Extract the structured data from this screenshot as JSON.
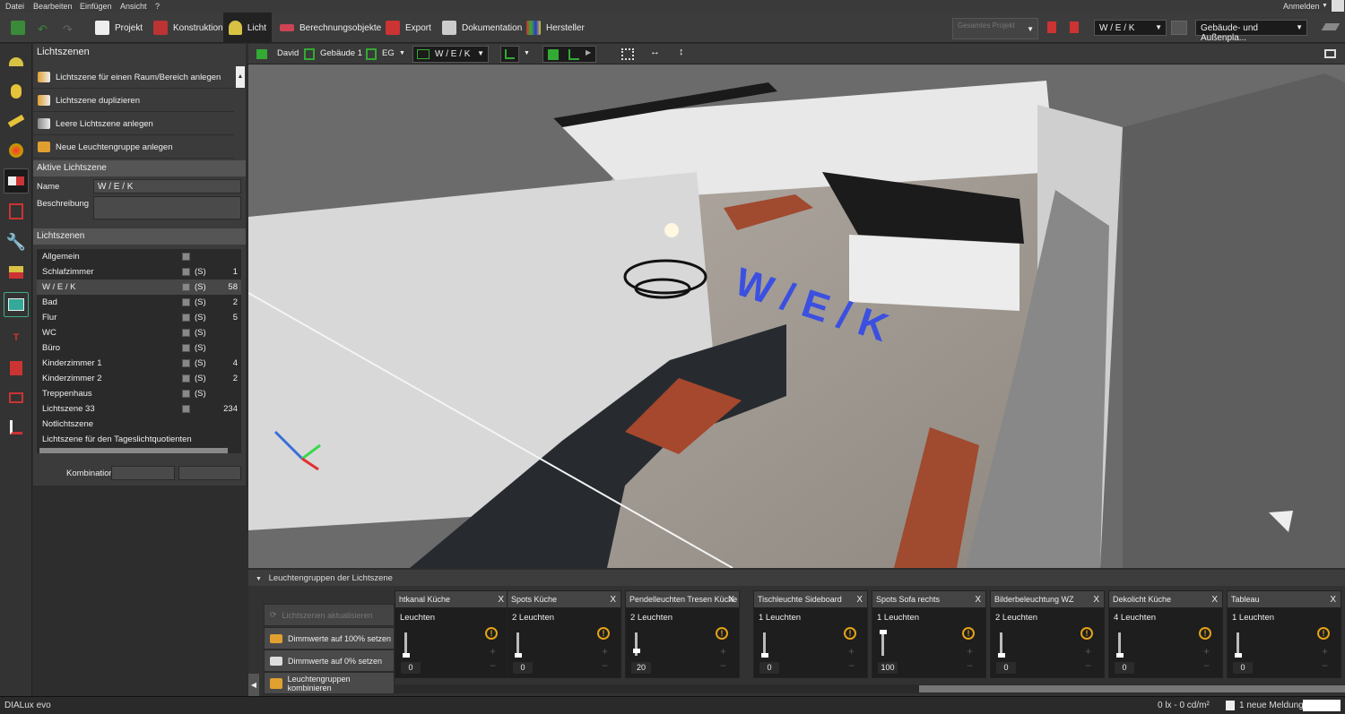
{
  "menu": [
    "Datei",
    "Bearbeiten",
    "Einfügen",
    "Ansicht",
    "?"
  ],
  "user": {
    "label": "Anmelden"
  },
  "tabs": [
    {
      "label": "Projekt"
    },
    {
      "label": "Konstruktion"
    },
    {
      "label": "Licht"
    },
    {
      "label": "Berechnungsobjekte"
    },
    {
      "label": "Export"
    },
    {
      "label": "Dokumentation"
    },
    {
      "label": "Hersteller"
    }
  ],
  "toolbar_right": {
    "project_combo": "Gesamtes Projekt",
    "scene_combo": "W / E / K",
    "view_combo": "Gebäude- und Außenpla..."
  },
  "viewbar": {
    "site": "David",
    "building": "Gebäude 1",
    "floor": "EG",
    "scene": "W / E / K"
  },
  "left": {
    "header": "Lichtszenen",
    "actions": [
      "Lichtszene für einen Raum/Bereich anlegen",
      "Lichtszene duplizieren",
      "Leere Lichtszene anlegen",
      "Neue Leuchtengruppe anlegen"
    ],
    "active_header": "Aktive Lichtszene",
    "name_label": "Name",
    "name_value": "W / E / K",
    "desc_label": "Beschreibung",
    "scenes_header": "Lichtszenen",
    "scenes": [
      {
        "name": "Allgemein",
        "s": "",
        "count": ""
      },
      {
        "name": "Schlafzimmer",
        "s": "(S)",
        "count": "1"
      },
      {
        "name": "W / E / K",
        "s": "(S)",
        "count": "58"
      },
      {
        "name": "Bad",
        "s": "(S)",
        "count": "2"
      },
      {
        "name": "Flur",
        "s": "(S)",
        "count": "5"
      },
      {
        "name": "WC",
        "s": "(S)",
        "count": ""
      },
      {
        "name": "Büro",
        "s": "(S)",
        "count": ""
      },
      {
        "name": "Kinderzimmer 1",
        "s": "(S)",
        "count": "4"
      },
      {
        "name": "Kinderzimmer 2",
        "s": "(S)",
        "count": "2"
      },
      {
        "name": "Treppenhaus",
        "s": "(S)",
        "count": ""
      },
      {
        "name": "Lichtszene 33",
        "s": "",
        "count": "234"
      },
      {
        "name": "Notlichtszene",
        "s": "",
        "count": ""
      },
      {
        "name": "Lichtszene für den Tageslichtquotienten",
        "s": "",
        "count": ""
      }
    ],
    "combo_label": "Kombination"
  },
  "scene_text": "W / E / K",
  "bottom": {
    "header": "Leuchtengruppen der Lichtszene",
    "buttons": [
      "Lichtszenen aktualisieren",
      "Dimmwerte auf 100% setzen",
      "Dimmwerte auf 0% setzen",
      "Leuchtengruppen kombinieren"
    ],
    "groups": [
      {
        "title": "htkanal Küche",
        "count": "Leuchten",
        "value": "0",
        "level": 0
      },
      {
        "title": "Spots Küche",
        "count": "2 Leuchten",
        "value": "0",
        "level": 0
      },
      {
        "title": "Pendelleuchten Tresen Küche",
        "count": "2 Leuchten",
        "value": "20",
        "level": 20
      },
      {
        "title": "Tischleuchte Sideboard",
        "count": "1 Leuchten",
        "value": "0",
        "level": 0
      },
      {
        "title": "Spots Sofa rechts",
        "count": "1 Leuchten",
        "value": "100",
        "level": 100
      },
      {
        "title": "Bilderbeleuchtung WZ",
        "count": "2 Leuchten",
        "value": "0",
        "level": 0
      },
      {
        "title": "Dekolicht Küche",
        "count": "4 Leuchten",
        "value": "0",
        "level": 0
      },
      {
        "title": "Tableau",
        "count": "1 Leuchten",
        "value": "0",
        "level": 0
      }
    ],
    "close": "X"
  },
  "status": {
    "app": "DIALux evo",
    "lux": "0 lx - 0 cd/m²",
    "messages": "1 neue Meldung"
  }
}
